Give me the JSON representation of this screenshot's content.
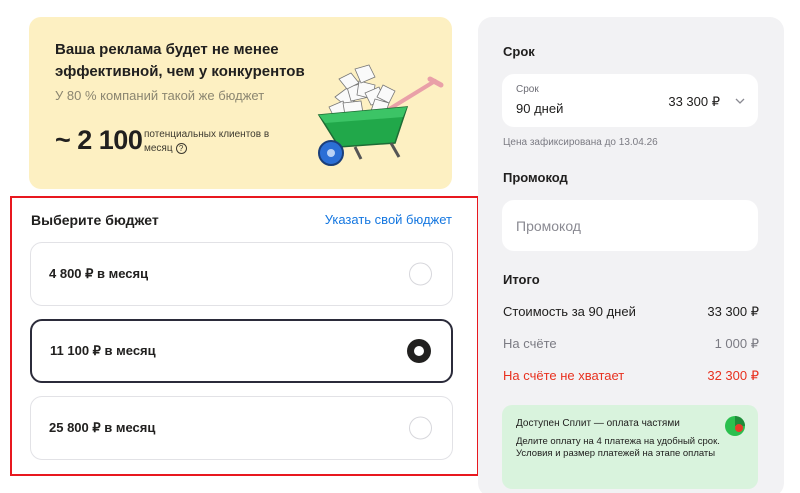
{
  "promo": {
    "title": "Ваша реклама будет не менее эффективной, чем у конкурентов",
    "subtitle": "У 80 % компаний такой же бюджет",
    "clients_value": "~ 2 100",
    "clients_note": "потенциальных клиентов в месяц",
    "help_icon": "?"
  },
  "budget": {
    "title": "Выберите бюджет",
    "custom_link": "Указать свой бюджет",
    "options": [
      {
        "label": "4 800 ₽ в месяц",
        "selected": false
      },
      {
        "label": "11 100 ₽ в месяц",
        "selected": true
      },
      {
        "label": "25 800 ₽ в месяц",
        "selected": false
      }
    ]
  },
  "summary": {
    "term_heading": "Срок",
    "term_caption": "Срок",
    "term_value": "90 дней",
    "term_price": "33 300 ₽",
    "fixed_note": "Цена зафиксирована до 13.04.26",
    "promocode_heading": "Промокод",
    "promocode_placeholder": "Промокод",
    "promocode_value": "",
    "total_heading": "Итого",
    "rows": [
      {
        "label": "Стоимость за 90 дней",
        "value": "33 300 ₽",
        "color": "#21201f"
      },
      {
        "label": "На счёте",
        "value": "1 000 ₽",
        "color": "#7b7b83"
      },
      {
        "label": "На счёте не хватает",
        "value": "32 300 ₽",
        "color": "#e8311f"
      }
    ],
    "split": {
      "title": "Доступен Сплит — оплата частями",
      "text": "Делите оплату на 4 платежа на удобный срок. Условия и размер платежей на этапе оплаты"
    }
  },
  "colors": {
    "accent": "#1577e0",
    "highlight_border": "#e8181f",
    "promo_bg": "#fdf0c2",
    "split_bg": "#d9f3dd"
  }
}
